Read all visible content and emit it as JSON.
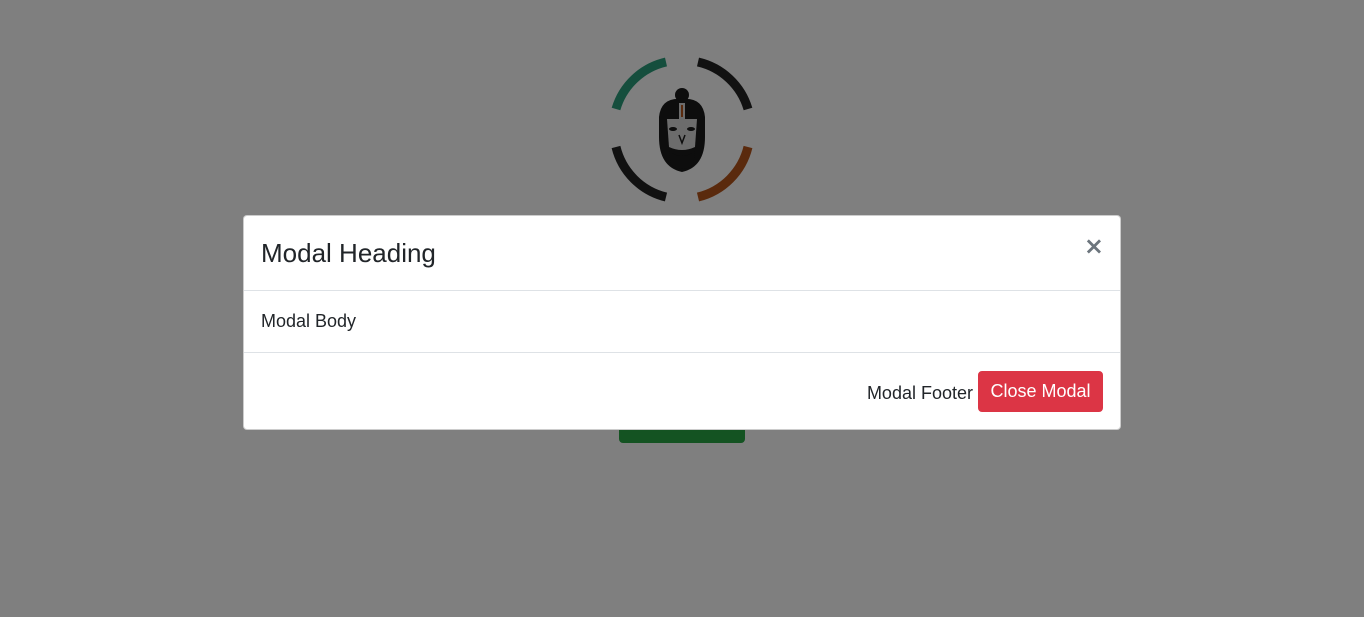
{
  "background": {
    "logo_icon": "hanuman-face-logo",
    "button_label": "",
    "accent_color": "#28a745"
  },
  "modal": {
    "title": "Modal Heading",
    "close_symbol": "×",
    "body_text": "Modal Body",
    "footer_text": "Modal Footer",
    "close_button_label": "Close Modal",
    "close_button_color": "#dc3545"
  }
}
